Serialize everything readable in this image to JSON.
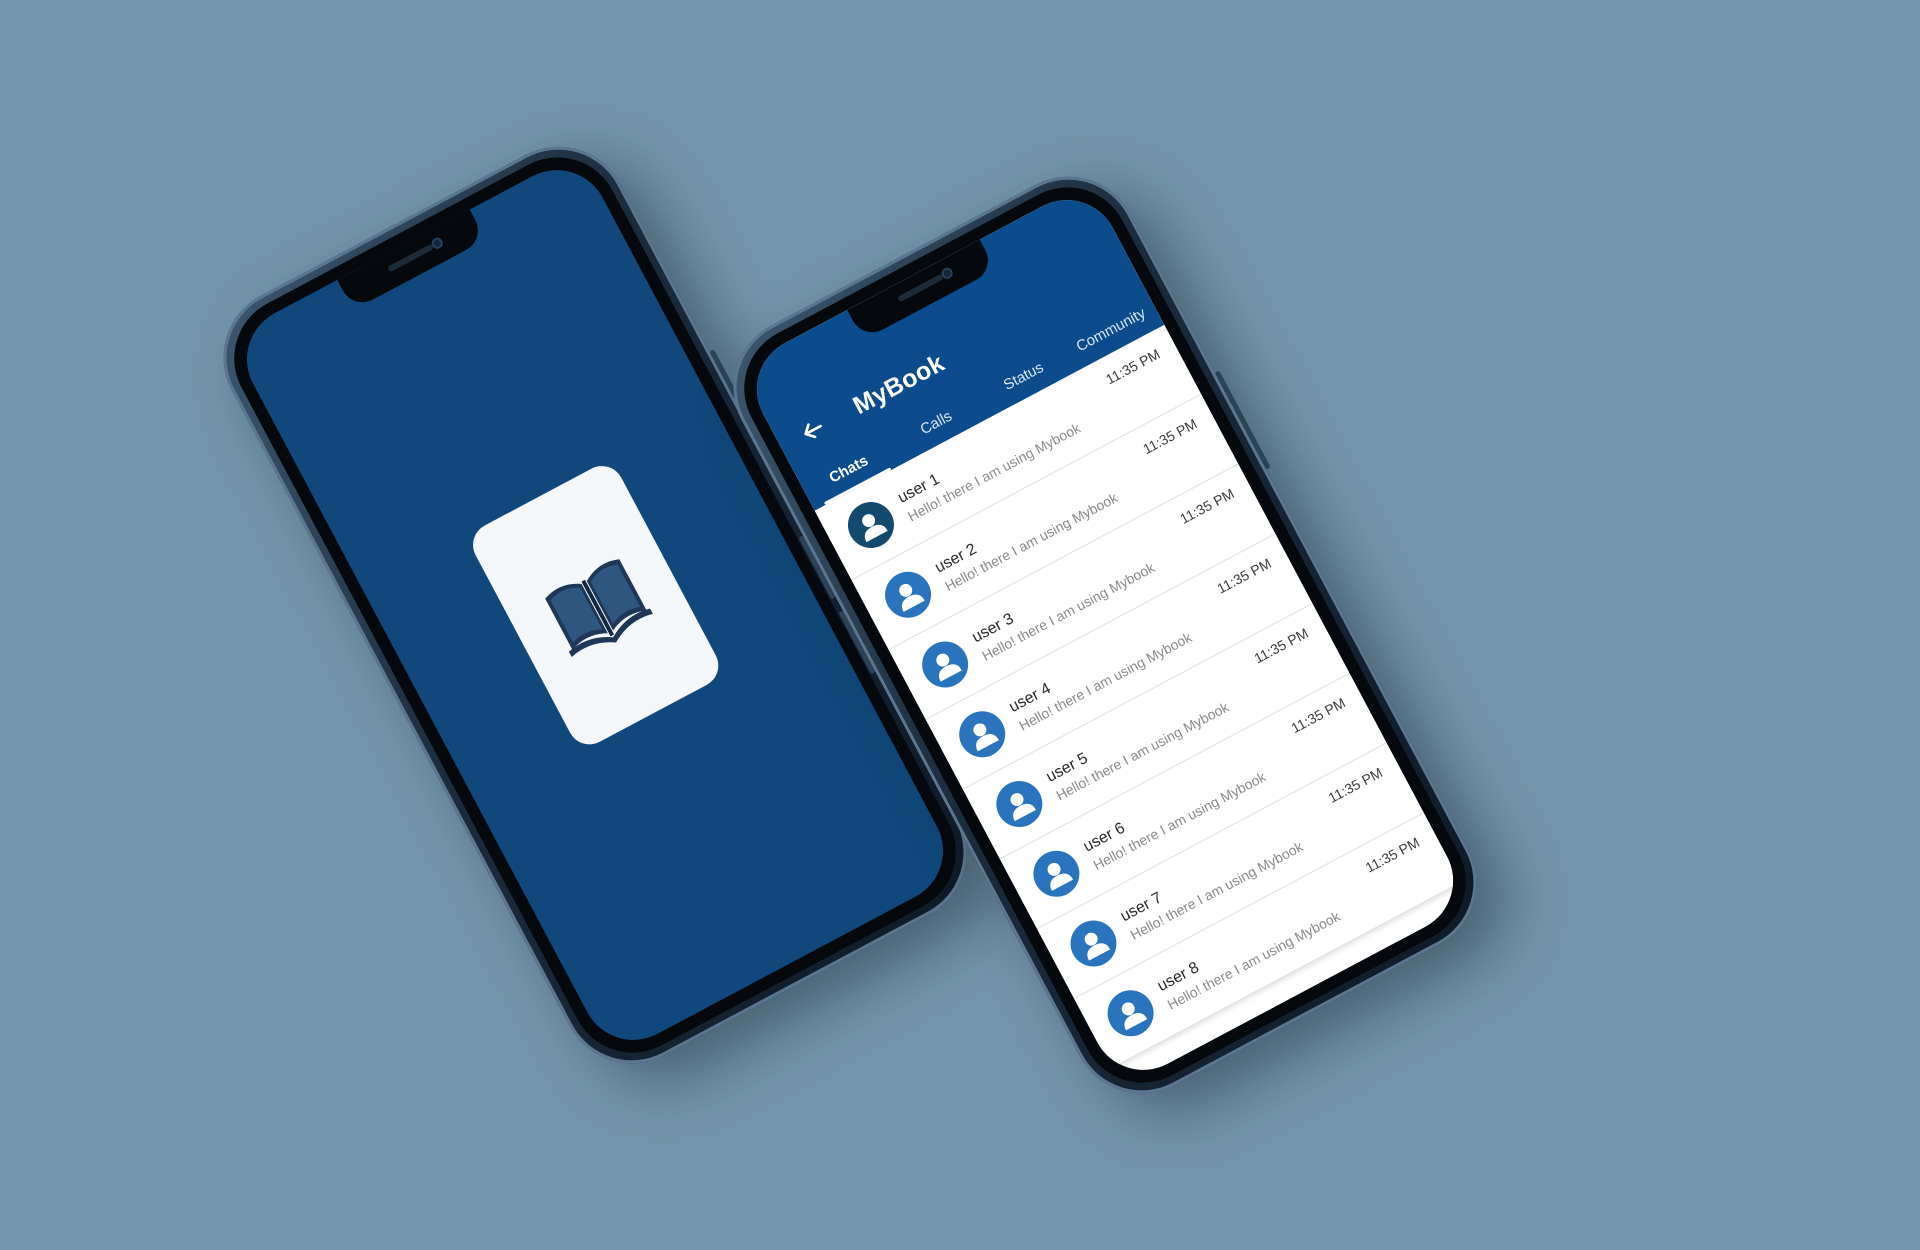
{
  "splash": {
    "logo_icon": "open-book-icon",
    "background": "#11477a"
  },
  "app": {
    "title": "MyBook",
    "back_icon": "arrow-left-icon",
    "accent": "#0c4c8c",
    "tabs": [
      {
        "label": "Chats",
        "active": true
      },
      {
        "label": "Calls",
        "active": false
      },
      {
        "label": "Status",
        "active": false
      },
      {
        "label": "Community",
        "active": false
      }
    ],
    "chats": [
      {
        "name": "user 1",
        "message": "Hello!  there I am using Mybook",
        "time": "11:35 PM"
      },
      {
        "name": "user 2",
        "message": "Hello!  there I am using Mybook",
        "time": "11:35 PM"
      },
      {
        "name": "user 3",
        "message": "Hello!  there I am using Mybook",
        "time": "11:35 PM"
      },
      {
        "name": "user 4",
        "message": "Hello!  there I am using Mybook",
        "time": "11:35 PM"
      },
      {
        "name": "user 5",
        "message": "Hello!  there I am using Mybook",
        "time": "11:35 PM"
      },
      {
        "name": "user 6",
        "message": "Hello!  there I am using Mybook",
        "time": "11:35 PM"
      },
      {
        "name": "user 7",
        "message": "Hello!  there I am using Mybook",
        "time": "11:35 PM"
      },
      {
        "name": "user 8",
        "message": "Hello!  there I am using Mybook",
        "time": "11:35 PM"
      }
    ]
  }
}
